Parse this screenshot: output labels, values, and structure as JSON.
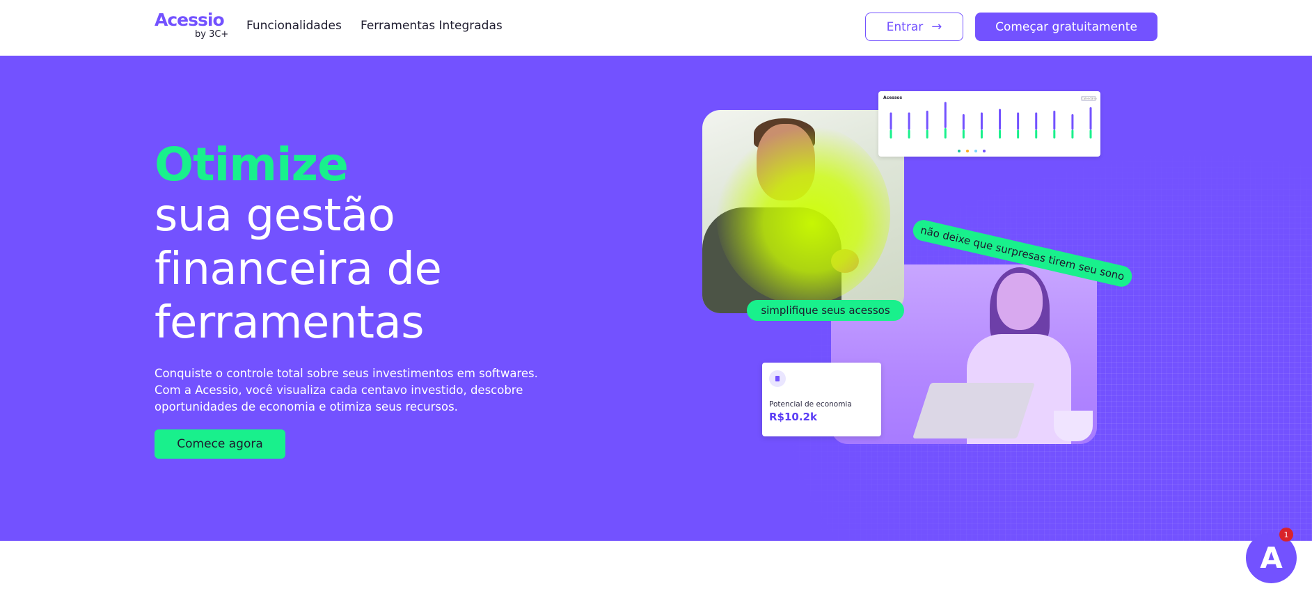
{
  "header": {
    "logo": {
      "brand": "Acessio",
      "sub": "by 3C+"
    },
    "nav": [
      {
        "label": "Funcionalidades"
      },
      {
        "label": "Ferramentas Integradas"
      }
    ],
    "login_label": "Entrar",
    "login_icon": "arrow-right-icon",
    "signup_label": "Começar gratuitamente"
  },
  "hero": {
    "headline_accent": "Otimize",
    "headline_lines": [
      "sua gestão",
      "financeira de",
      "ferramentas"
    ],
    "description_lines": [
      "Conquiste o controle total sobre seus investimentos em softwares.",
      "Com a Acessio, você visualiza cada centavo investido, descobre",
      "oportunidades de economia e otimiza seus recursos."
    ],
    "cta_label": "Comece agora",
    "pill_simplifique": "simplifique seus acessos",
    "pill_surpresas": "não deixe que surpresas tirem seu sono",
    "economy_card": {
      "label": "Potencial de economia",
      "value": "R$10.2k",
      "icon": "document-icon"
    },
    "chart_card": {
      "title": "Acessos",
      "chip": "Calendário"
    }
  },
  "chart_data": {
    "type": "bar",
    "title": "Acessos",
    "categories": [
      "",
      "",
      "",
      "",
      "",
      "",
      "",
      "",
      "",
      "",
      "",
      ""
    ],
    "series": [
      {
        "values": [
          10,
          10,
          11,
          15,
          9,
          10,
          12,
          10,
          10,
          11,
          9,
          13
        ],
        "color": "#7352ff"
      },
      {
        "values": [
          5,
          5,
          5,
          6,
          5,
          5,
          5,
          5,
          5,
          5,
          5,
          5
        ],
        "color": "#19f08c"
      }
    ],
    "ylim": [
      0,
      20
    ],
    "legend": [
      {
        "color": "#19c3a0"
      },
      {
        "color": "#ffb020"
      },
      {
        "color": "#7ad6ff"
      },
      {
        "color": "#7352ff"
      }
    ]
  },
  "widget": {
    "letter": "A",
    "badge": "1"
  },
  "colors": {
    "primary": "#7352ff",
    "accent": "#19f08c",
    "badge": "#d9232a"
  }
}
